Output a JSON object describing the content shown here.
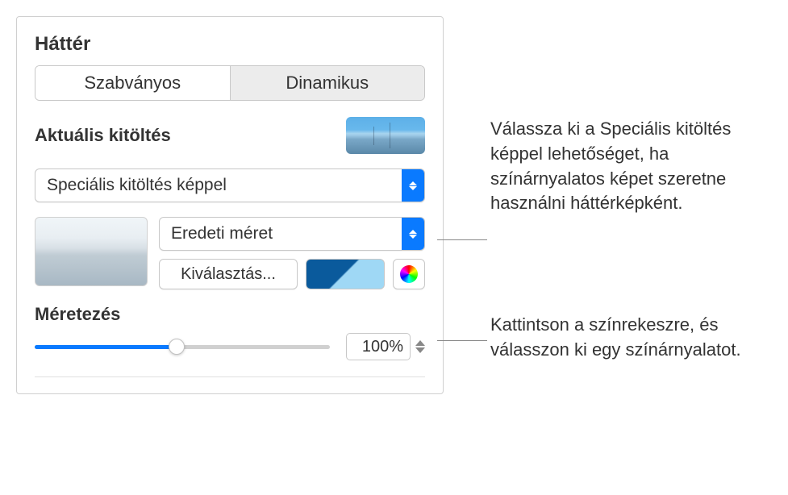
{
  "header": {
    "title": "Háttér"
  },
  "tabs": {
    "standard": "Szabványos",
    "dynamic": "Dinamikus"
  },
  "current_fill": {
    "label": "Aktuális kitöltés"
  },
  "fill_type": {
    "selected": "Speciális kitöltés képpel"
  },
  "image_size": {
    "selected": "Eredeti méret"
  },
  "choose_button": {
    "label": "Kiválasztás..."
  },
  "sizing": {
    "label": "Méretezés",
    "value": "100%"
  },
  "callouts": {
    "c1": "Válassza ki a Speciális kitöltés képpel lehetőséget, ha színárnyalatos képet szeretne használni háttérképként.",
    "c2": "Kattintson a színrekeszre, és válasszon ki egy színárnyalatot."
  }
}
